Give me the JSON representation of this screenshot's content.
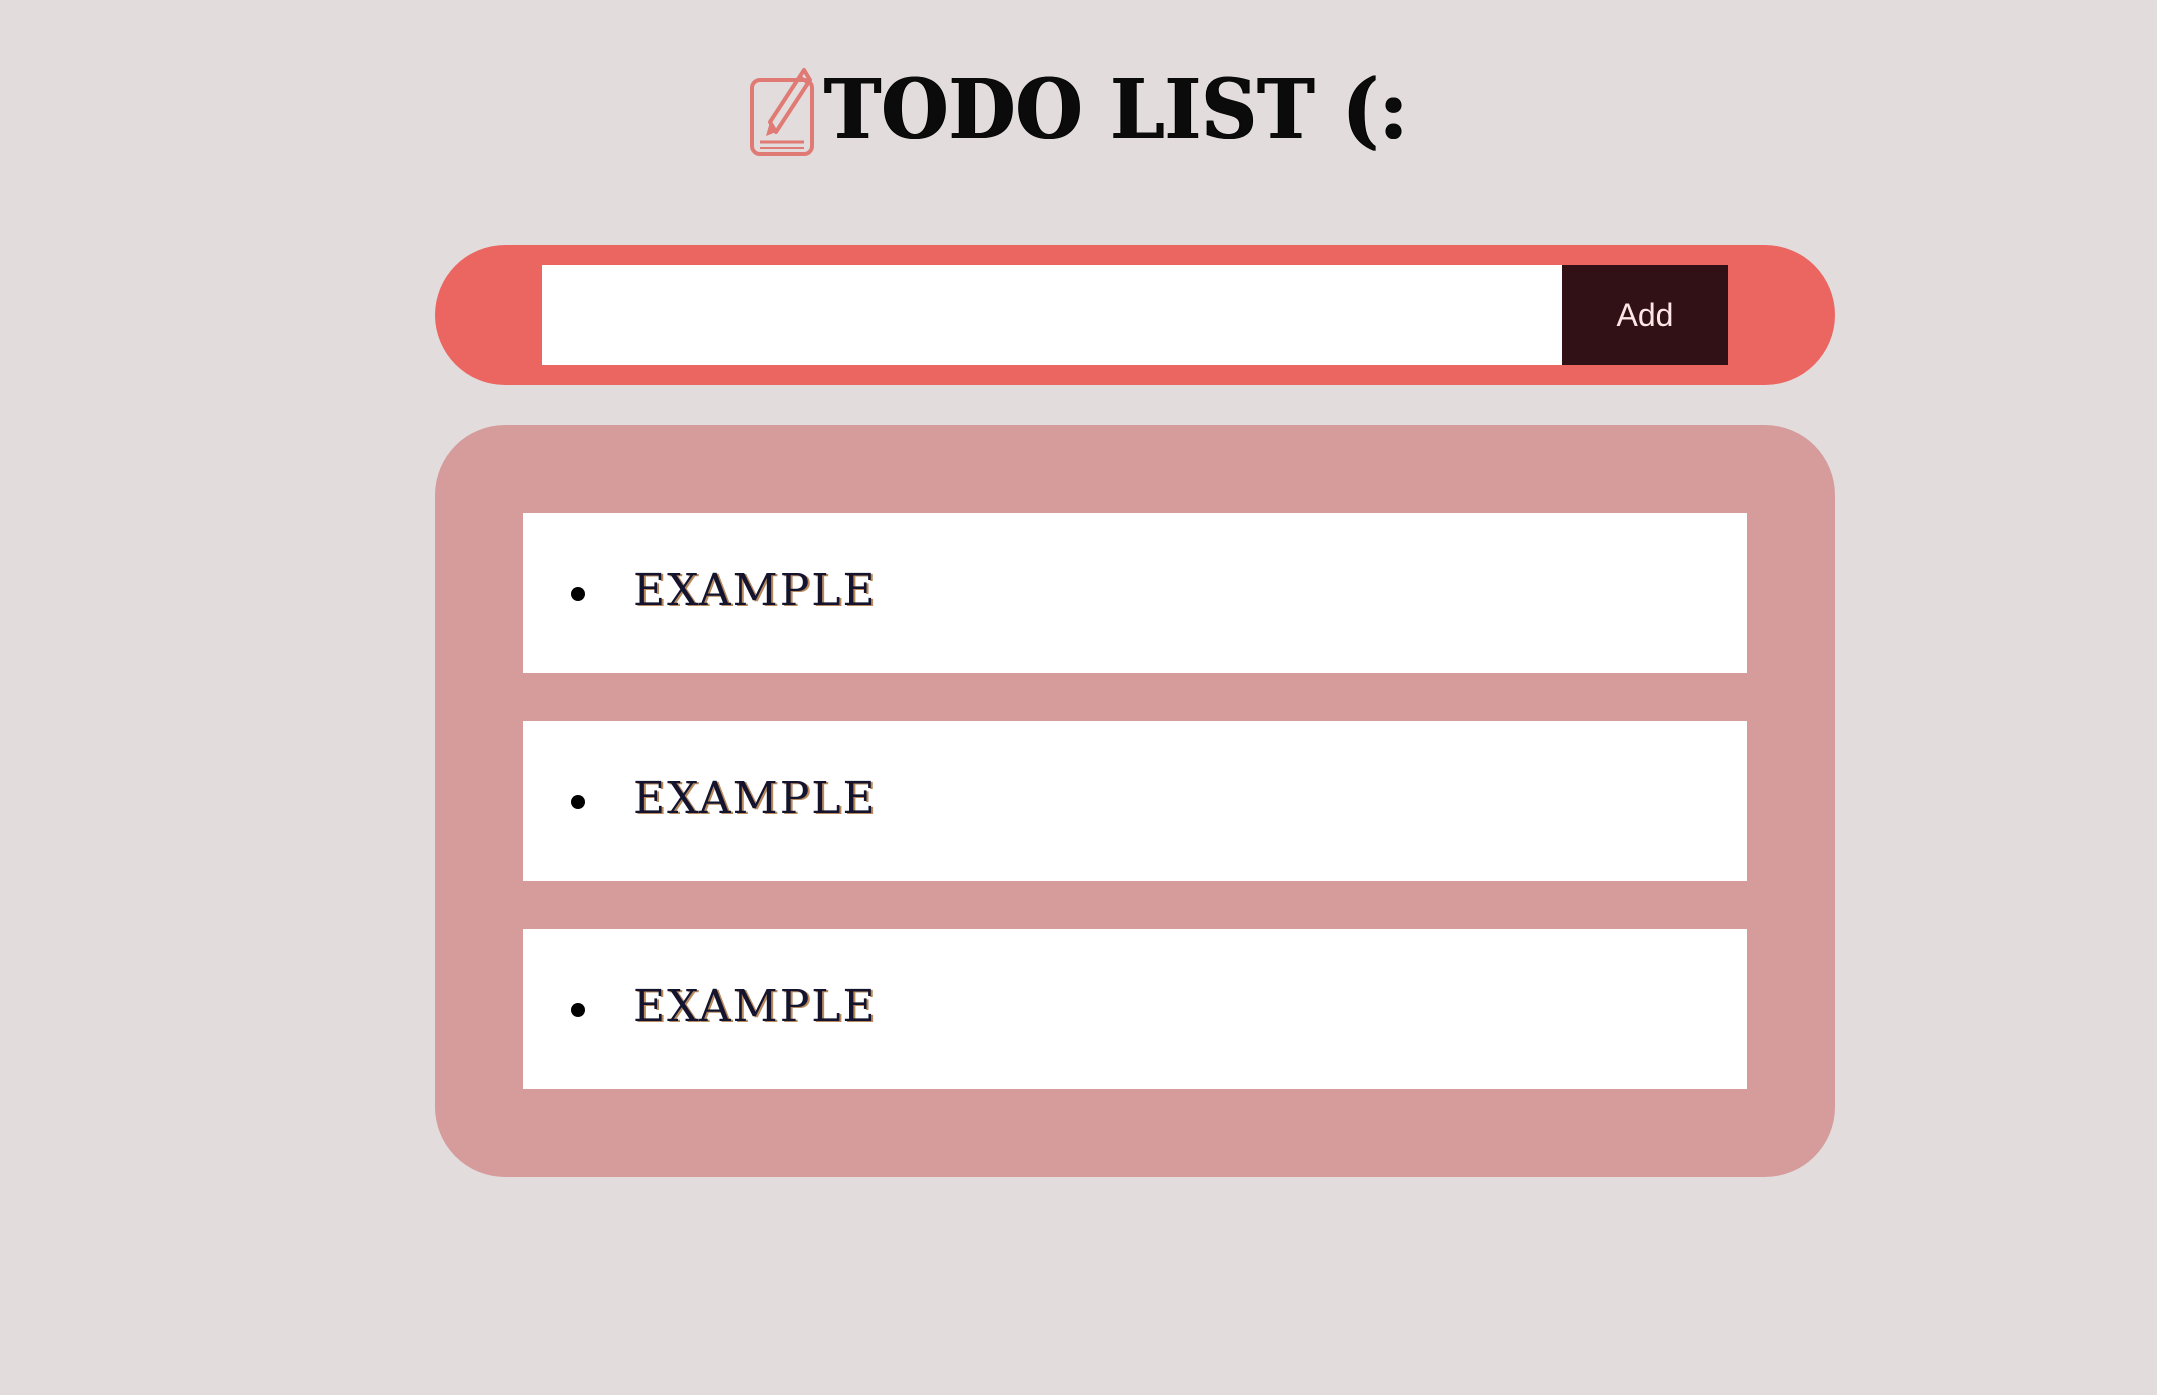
{
  "header": {
    "title": "TODO LIST (:",
    "icon": "pencil-notepad-icon"
  },
  "form": {
    "input_value": "",
    "input_placeholder": "",
    "add_label": "Add"
  },
  "todos": [
    {
      "text": "EXAMPLE"
    },
    {
      "text": "EXAMPLE"
    },
    {
      "text": "EXAMPLE"
    }
  ],
  "colors": {
    "background": "#e2dcdc",
    "add_bar": "#ec6661",
    "add_button": "#311115",
    "list_panel": "#d69c9c",
    "item_background": "#ffffff",
    "icon": "#e07a74"
  }
}
